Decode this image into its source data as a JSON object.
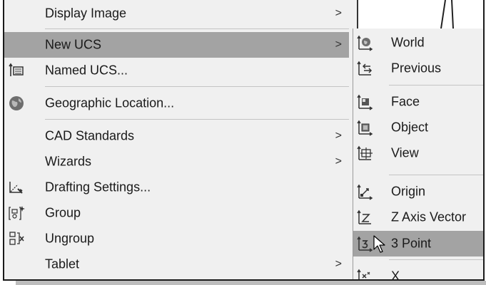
{
  "main_menu": {
    "items": [
      {
        "label": "Display Image",
        "has_submenu": true
      },
      {
        "label": "New UCS",
        "has_submenu": true,
        "highlighted": true
      },
      {
        "label": "Named UCS...",
        "icon": "ucs-list-icon"
      },
      {
        "label": "Geographic Location...",
        "icon": "globe-icon"
      },
      {
        "label": "CAD Standards",
        "has_submenu": true
      },
      {
        "label": "Wizards",
        "has_submenu": true
      },
      {
        "label": "Drafting Settings...",
        "icon": "drafting-settings-icon"
      },
      {
        "label": "Group",
        "icon": "group-icon"
      },
      {
        "label": "Ungroup",
        "icon": "ungroup-icon"
      },
      {
        "label": "Tablet",
        "has_submenu": true
      }
    ]
  },
  "arrow_glyph": ">",
  "sub_menu": {
    "items": [
      {
        "label": "World",
        "icon": "ucs-world-icon"
      },
      {
        "label": "Previous",
        "icon": "ucs-previous-icon"
      },
      {
        "label": "Face",
        "icon": "ucs-face-icon"
      },
      {
        "label": "Object",
        "icon": "ucs-object-icon"
      },
      {
        "label": "View",
        "icon": "ucs-view-icon"
      },
      {
        "label": "Origin",
        "icon": "ucs-origin-icon"
      },
      {
        "label": "Z Axis Vector",
        "icon": "ucs-z-axis-icon"
      },
      {
        "label": "3 Point",
        "icon": "ucs-3point-icon",
        "highlighted": true
      },
      {
        "label": "X",
        "icon": "ucs-x-icon"
      }
    ]
  },
  "colors": {
    "menu_bg": "#f0f0f0",
    "highlight": "#a3a3a3",
    "text": "#1a1a1a"
  }
}
